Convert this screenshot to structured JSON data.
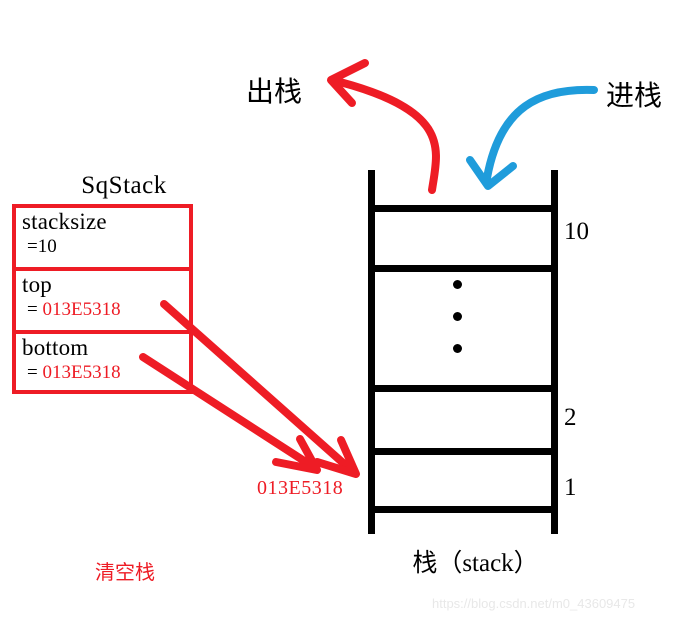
{
  "diagram": {
    "title_cn": "栈（stack）",
    "struct": {
      "name": "SqStack",
      "fields": [
        {
          "name": "stacksize",
          "value": "=10",
          "value_color": "black"
        },
        {
          "name": "top",
          "value_prefix": "= ",
          "value": "013E5318",
          "value_color": "red"
        },
        {
          "name": "bottom",
          "value_prefix": "= ",
          "value": "013E5318",
          "value_color": "red"
        }
      ],
      "border_color": "#ee1c25"
    },
    "stack": {
      "caption": "栈（stack）",
      "indices": [
        "10",
        "2",
        "1"
      ],
      "ellipsis": "⋮",
      "cell_count": 5,
      "border_color": "#000000"
    },
    "labels": {
      "pop": "出栈",
      "push": "进栈",
      "clear": "清空栈",
      "address": "013E5318"
    },
    "arrows": {
      "pop_arrow_color": "#ee1c25",
      "push_arrow_color": "#1f9cdb",
      "pointer_arrow_color": "#ee1c25"
    },
    "watermark": "https://blog.csdn.net/m0_43609475"
  }
}
